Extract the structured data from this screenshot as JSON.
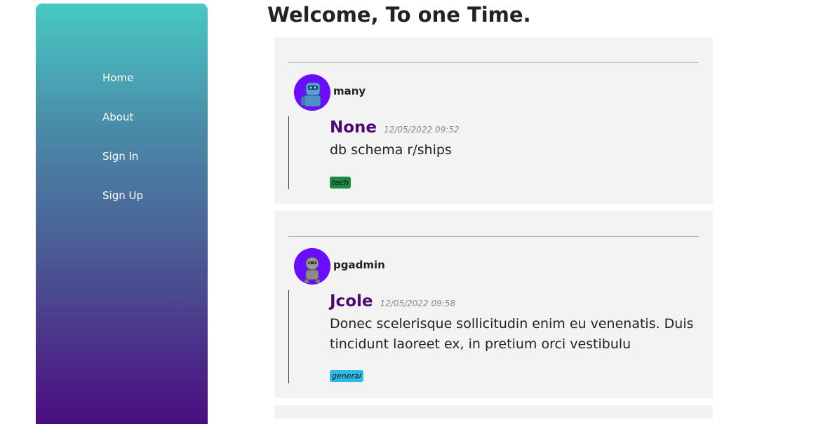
{
  "nav": {
    "items": [
      {
        "label": "Home"
      },
      {
        "label": "About"
      },
      {
        "label": "Sign In"
      },
      {
        "label": "Sign Up"
      }
    ]
  },
  "page": {
    "title": "Welcome, To one Time."
  },
  "posts": [
    {
      "username": "many",
      "author": "None",
      "date": "12/05/2022 09:52",
      "body": "db schema r/ships",
      "tag": "tech",
      "tag_color": "#1a8a47",
      "avatar_icon": "robot-blue-icon"
    },
    {
      "username": "pgadmin",
      "author": "Jcole",
      "date": "12/05/2022 09:58",
      "body": "Donec scelerisque sollicitudin enim eu venenatis. Duis tincidunt laoreet ex, in pretium orci vestibulu",
      "tag": "general",
      "tag_color": "#2ebce6",
      "avatar_icon": "robot-gray-icon"
    }
  ],
  "colors": {
    "sidebar_gradient_top": "#47c9c3",
    "sidebar_gradient_bottom": "#4b0d80",
    "author_color": "#4d0a75",
    "avatar_bg": "#6a0dff",
    "card_bg": "#f3f3f3"
  }
}
